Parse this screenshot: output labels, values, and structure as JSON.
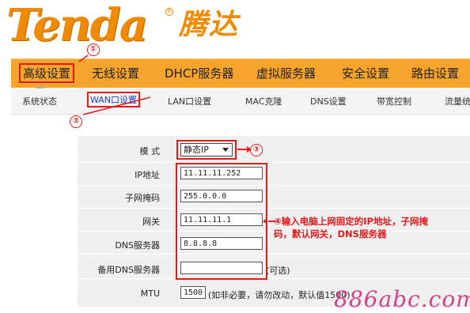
{
  "logo": {
    "brand_en": "Tenda",
    "brand_cn": "腾达",
    "reg": "R"
  },
  "menu": {
    "items": [
      {
        "label": "高级设置"
      },
      {
        "label": "无线设置"
      },
      {
        "label": "DHCP服务器"
      },
      {
        "label": "虚拟服务器"
      },
      {
        "label": "安全设置"
      },
      {
        "label": "路由设置"
      }
    ]
  },
  "submenu": {
    "items": [
      {
        "label": "系统状态"
      },
      {
        "label": "WAN口设置"
      },
      {
        "label": "LAN口设置"
      },
      {
        "label": "MAC克隆"
      },
      {
        "label": "DNS设置"
      },
      {
        "label": "带宽控制"
      },
      {
        "label": "流量统"
      }
    ]
  },
  "form": {
    "mode_label": "模 式",
    "mode_value": "静态IP",
    "ip_label": "IP地址",
    "ip_value": "11.11.11.252",
    "mask_label": "子网掩码",
    "mask_value": "255.0.0.0",
    "gateway_label": "网关",
    "gateway_value": "11.11.11.1",
    "dns_label": "DNS服务器",
    "dns_value": "8.8.8.8",
    "dns2_label": "备用DNS服务器",
    "dns2_value": "",
    "dns2_hint": "(可选)",
    "mtu_label": "MTU",
    "mtu_value": "1500",
    "mtu_hint": "(如非必要，请勿改动，默认值1500)"
  },
  "annotations": {
    "n1": "①",
    "n2": "②",
    "n3": "③",
    "note": "④输入电脑上网固定的IP地址，子网掩码，默认网关，DNS服务器"
  },
  "watermark": "886abc.com",
  "colors": {
    "brand": "#f08a00",
    "menu_bg": "#f6a42c",
    "highlight": "#e01b1b",
    "link": "#1f3fc7"
  }
}
